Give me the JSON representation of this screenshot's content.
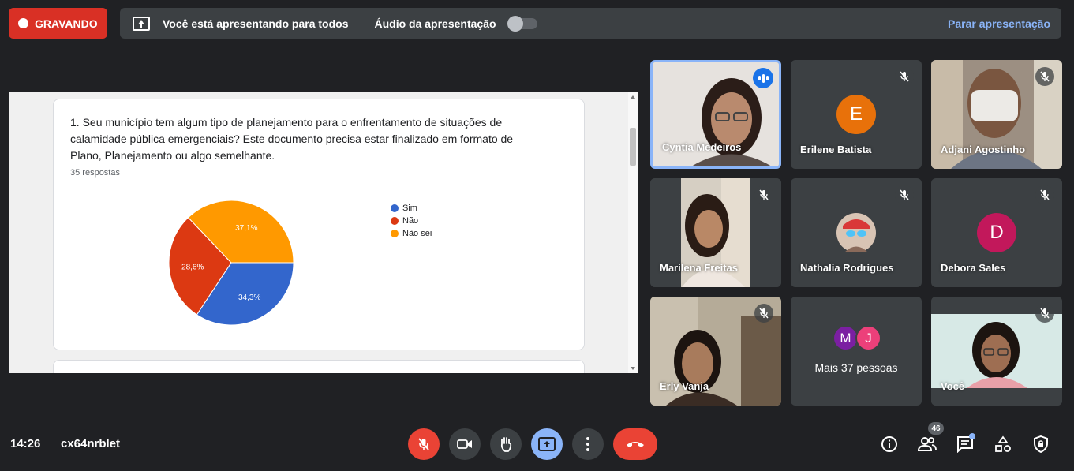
{
  "top_bar": {
    "recording_label": "GRAVANDO",
    "presenting_text": "Você está apresentando para todos",
    "audio_label": "Áudio da apresentação",
    "stop_label": "Parar apresentação",
    "audio_toggle_on": false
  },
  "shared_doc": {
    "question": "1. Seu município tem algum tipo de planejamento para o enfrentamento de situações de calamidade pública emergenciais? Este documento precisa estar finalizado em formato de Plano, Planejamento ou algo semelhante.",
    "responses": "35 respostas"
  },
  "chart_data": {
    "type": "pie",
    "categories": [
      "Sim",
      "Não",
      "Não sei"
    ],
    "values": [
      34.3,
      28.6,
      37.1
    ],
    "labels": [
      "34,3%",
      "28,6%",
      "37,1%"
    ],
    "colors": [
      "#3366cc",
      "#dc3912",
      "#ff9900"
    ],
    "legend_position": "right"
  },
  "participants": [
    {
      "name": "Cyntia Medeiros",
      "type": "video",
      "speaking": true
    },
    {
      "name": "Erilene Batista",
      "type": "avatar",
      "initial": "E",
      "color": "#e8710a"
    },
    {
      "name": "Adjani Agostinho",
      "type": "video"
    },
    {
      "name": "Marilena Freitas",
      "type": "video"
    },
    {
      "name": "Nathalia Rodrigues",
      "type": "photo-avatar"
    },
    {
      "name": "Debora Sales",
      "type": "avatar",
      "initial": "D",
      "color": "#c2185b"
    },
    {
      "name": "Erly Vanja",
      "type": "video"
    },
    {
      "name": "Você",
      "type": "video"
    }
  ],
  "more_people": {
    "label": "Mais 37 pessoas",
    "initials": [
      "M",
      "J"
    ],
    "colors": [
      "#7b1fa2",
      "#ec407a"
    ]
  },
  "bottom_bar": {
    "time": "14:26",
    "meeting_code": "cx64nrblet",
    "participant_count": "46"
  }
}
